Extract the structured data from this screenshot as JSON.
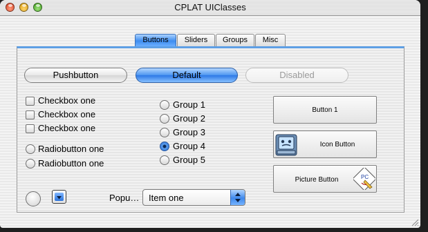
{
  "window": {
    "title": "CPLAT UIClasses"
  },
  "tabs": [
    {
      "label": "Buttons",
      "selected": true
    },
    {
      "label": "Sliders",
      "selected": false
    },
    {
      "label": "Groups",
      "selected": false
    },
    {
      "label": "Misc",
      "selected": false
    }
  ],
  "push_buttons": {
    "pushbutton": "Pushbutton",
    "default": "Default",
    "disabled": "Disabled"
  },
  "checkboxes": [
    {
      "label": "Checkbox one",
      "checked": false
    },
    {
      "label": "Checkbox one",
      "checked": false
    },
    {
      "label": "Checkbox one",
      "checked": false
    }
  ],
  "radiobuttons": [
    {
      "label": "Radiobutton one",
      "selected": false
    },
    {
      "label": "Radiobutton one",
      "selected": false
    }
  ],
  "group_radios": [
    {
      "label": "Group 1",
      "selected": false
    },
    {
      "label": "Group 2",
      "selected": false
    },
    {
      "label": "Group 3",
      "selected": false
    },
    {
      "label": "Group 4",
      "selected": true
    },
    {
      "label": "Group 5",
      "selected": false
    }
  ],
  "bevel_buttons": {
    "button1": "Button 1",
    "icon_button": "Icon Button",
    "picture_button": "Picture Button",
    "picture_glyph": "PC"
  },
  "popup": {
    "label": "Popu…",
    "value": "Item one"
  },
  "colors": {
    "accent": "#3e8df0",
    "tab_active": "#6aaeff"
  }
}
